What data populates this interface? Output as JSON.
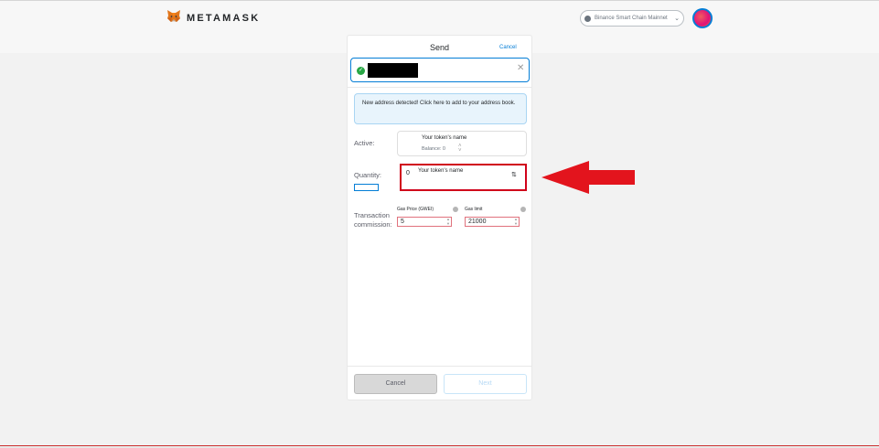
{
  "header": {
    "brand": "METAMASK",
    "network_label": "Binance Smart Chain Mainnet"
  },
  "send": {
    "title": "Send",
    "cancel_link": "Cancel",
    "notice": "New address detected! Click here to add to your address book.",
    "asset_label": "Active:",
    "asset_name": "Your token's name",
    "asset_balance": "Balance: 0",
    "quantity_label": "Quantity:",
    "quantity_value": "0",
    "quantity_token": "Your token's name",
    "commission_label_line1": "Transaction",
    "commission_label_line2": "commission:",
    "gas_price_label": "Gas Price (GWEI)",
    "gas_price_value": "5",
    "gas_limit_label": "Gas limit",
    "gas_limit_value": "21000",
    "cancel_button": "Cancel",
    "next_button": "Next"
  },
  "colors": {
    "accent": "#037dd6",
    "highlight": "#d0021b",
    "arrow": "#e3141d",
    "success": "#28a745"
  }
}
